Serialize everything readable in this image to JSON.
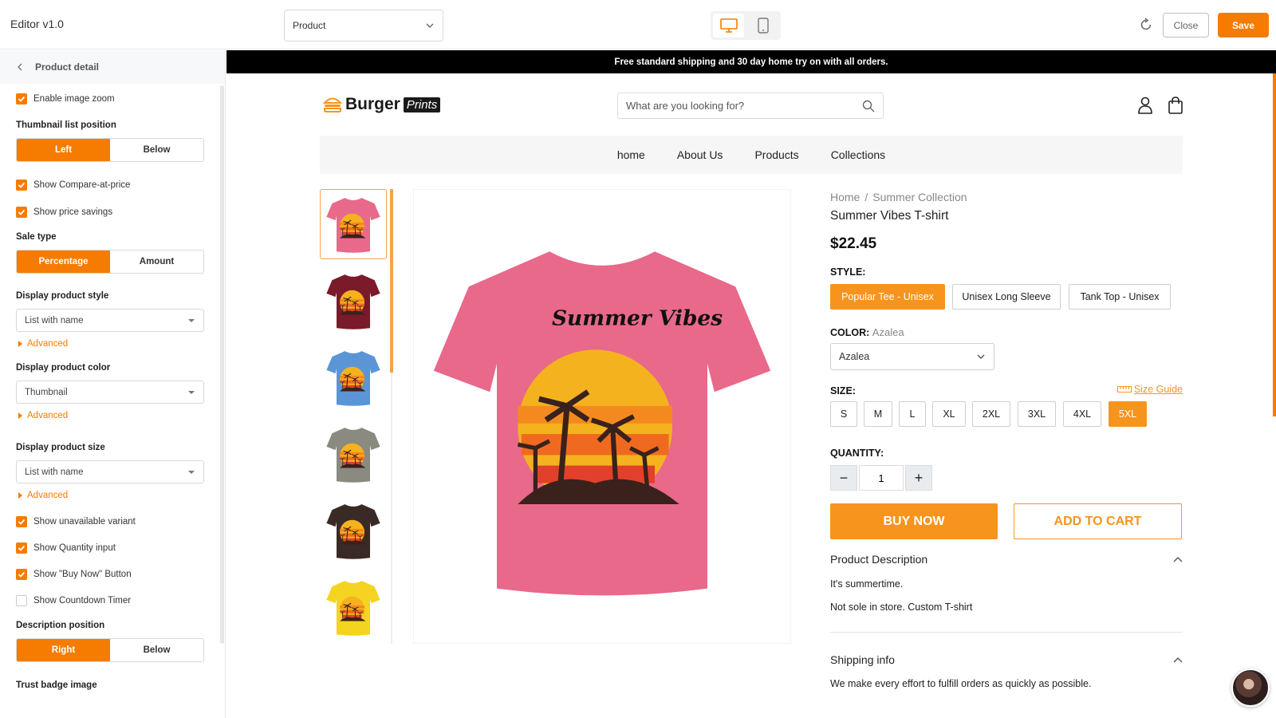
{
  "app": {
    "title": "Editor v1.0"
  },
  "topbar": {
    "page_select": "Product",
    "close_label": "Close",
    "save_label": "Save"
  },
  "sidebar": {
    "header": "Product detail",
    "enable_image_zoom": "Enable image zoom",
    "thumbnail_position": {
      "label": "Thumbnail list position",
      "options": [
        "Left",
        "Below"
      ],
      "selected": "Left"
    },
    "show_compare_price": "Show Compare-at-price",
    "show_price_savings": "Show price savings",
    "sale_type": {
      "label": "Sale type",
      "options": [
        "Percentage",
        "Amount"
      ],
      "selected": "Percentage"
    },
    "display_product_style": {
      "label": "Display product style",
      "value": "List with name"
    },
    "display_product_color": {
      "label": "Display product color",
      "value": "Thumbnail"
    },
    "display_product_size": {
      "label": "Display product size",
      "value": "List with name"
    },
    "advanced_label": "Advanced",
    "show_unavailable_variant": "Show unavailable variant",
    "show_quantity_input": "Show Quantity input",
    "show_buy_now": "Show \"Buy Now\" Button",
    "show_countdown_timer": "Show Countdown Timer",
    "description_position": {
      "label": "Description position",
      "options": [
        "Right",
        "Below"
      ],
      "selected": "Right"
    },
    "trust_badge_label": "Trust badge image"
  },
  "store": {
    "promo": "Free standard shipping and 30 day home try on with all orders.",
    "brand_name": "Burger",
    "brand_tag": "Prints",
    "search_placeholder": "What are you looking for?",
    "nav": [
      "home",
      "About Us",
      "Products",
      "Collections"
    ]
  },
  "product": {
    "breadcrumb": [
      "Home",
      "/",
      "Summer Collection"
    ],
    "title": "Summer Vibes T-shirt",
    "price": "$22.45",
    "style_label": "STYLE:",
    "styles": [
      "Popular Tee - Unisex",
      "Unisex Long Sleeve",
      "Tank Top - Unisex"
    ],
    "selected_style": "Popular Tee - Unisex",
    "color_label": "COLOR:",
    "color_value": "Azalea",
    "color_options_selected": "Azalea",
    "size_label": "SIZE:",
    "size_guide": "Size Guide",
    "sizes": [
      "S",
      "M",
      "L",
      "XL",
      "2XL",
      "3XL",
      "4XL",
      "5XL"
    ],
    "selected_size": "5XL",
    "quantity_label": "QUANTITY:",
    "quantity": "1",
    "buy_now": "BUY NOW",
    "add_to_cart": "ADD TO CART",
    "description_title": "Product Description",
    "description_lines": [
      "It's summertime.",
      "Not sole in store. Custom T-shirt"
    ],
    "shipping_title": "Shipping info",
    "shipping_text": "We make every effort to fulfill orders as quickly as possible.",
    "shirt_print_text": "Summer Vibes",
    "thumb_colors": [
      "#e8698a",
      "#7a1a2a",
      "#5b95d6",
      "#8a8a80",
      "#3a2a26",
      "#f5d321"
    ],
    "main_color": "#e8698a"
  },
  "colors": {
    "accent": "#f57c00",
    "accent_store": "#f7941d"
  }
}
